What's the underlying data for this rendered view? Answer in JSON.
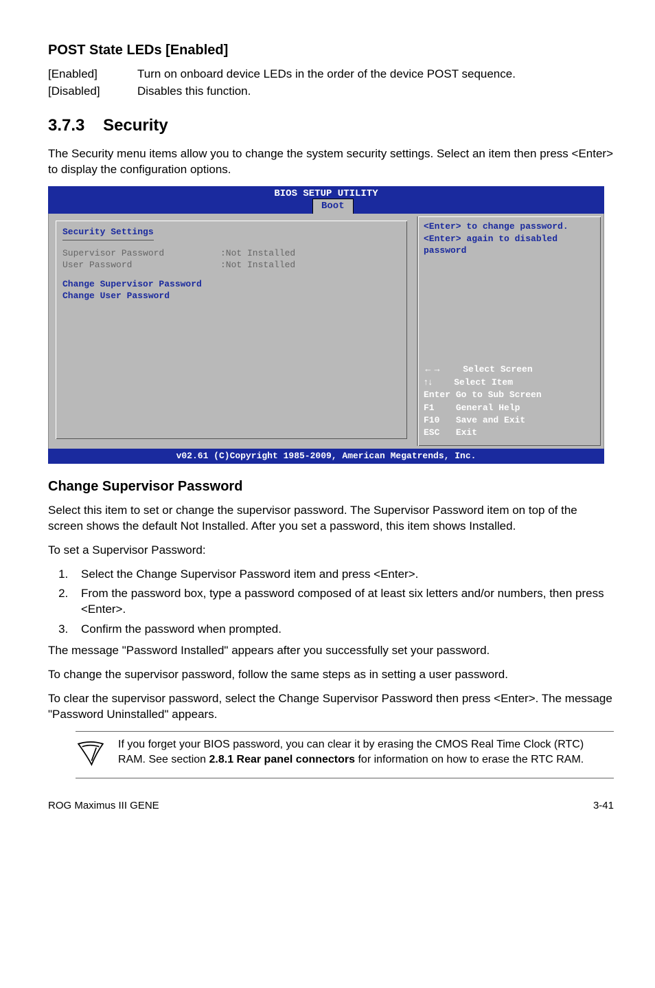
{
  "post_state": {
    "title": "POST State LEDs [Enabled]",
    "rows": [
      {
        "term": "[Enabled]",
        "def": "Turn on onboard device LEDs in the order of the device POST sequence."
      },
      {
        "term": "[Disabled]",
        "def": "Disables this function."
      }
    ]
  },
  "security_section": {
    "number": "3.7.3",
    "title": "Security",
    "intro": "The Security menu items allow you to change the system security settings. Select an item then press <Enter> to display the configuration options."
  },
  "bios": {
    "title": "BIOS SETUP UTILITY",
    "tab": "Boot",
    "panel_title": "Security Settings",
    "fields": [
      {
        "label": "Supervisor Password",
        "value": ":Not Installed"
      },
      {
        "label": "User Password",
        "value": ":Not Installed"
      }
    ],
    "links": [
      "Change Supervisor Password",
      "Change User Password"
    ],
    "help_top": "<Enter> to change password.\n<Enter> again to disabled password",
    "keys": [
      {
        "k": "←→",
        "d": "Select Screen"
      },
      {
        "k": "↑↓",
        "d": "Select Item"
      },
      {
        "k": "Enter",
        "d": "Go to Sub Screen"
      },
      {
        "k": "F1",
        "d": "General Help"
      },
      {
        "k": "F10",
        "d": "Save and Exit"
      },
      {
        "k": "ESC",
        "d": "Exit"
      }
    ],
    "footer": "v02.61 (C)Copyright 1985-2009, American Megatrends, Inc."
  },
  "change_pw": {
    "title": "Change Supervisor Password",
    "p1": "Select this item to set or change the supervisor password. The Supervisor Password item on top of the screen shows the default Not Installed. After you set a password, this item shows Installed.",
    "p2": "To set a Supervisor Password:",
    "steps": [
      "Select the Change Supervisor Password item and press <Enter>.",
      "From the password box, type a password composed of at least six letters and/or numbers, then press <Enter>.",
      "Confirm the password when prompted."
    ],
    "after_steps": "The message \"Password Installed\" appears after you successfully set your password.",
    "p3": "To change the supervisor password, follow the same steps as in setting a user password.",
    "p4": "To clear the supervisor password, select the Change Supervisor Password then press <Enter>. The message \"Password Uninstalled\" appears."
  },
  "note": {
    "text_before": "If you forget your BIOS password, you can clear it by erasing the CMOS Real Time Clock (RTC) RAM. See section ",
    "bold": "2.8.1 Rear panel connectors",
    "text_after": " for information on how to erase the RTC RAM."
  },
  "footer": {
    "left": "ROG Maximus III GENE",
    "right": "3-41"
  }
}
